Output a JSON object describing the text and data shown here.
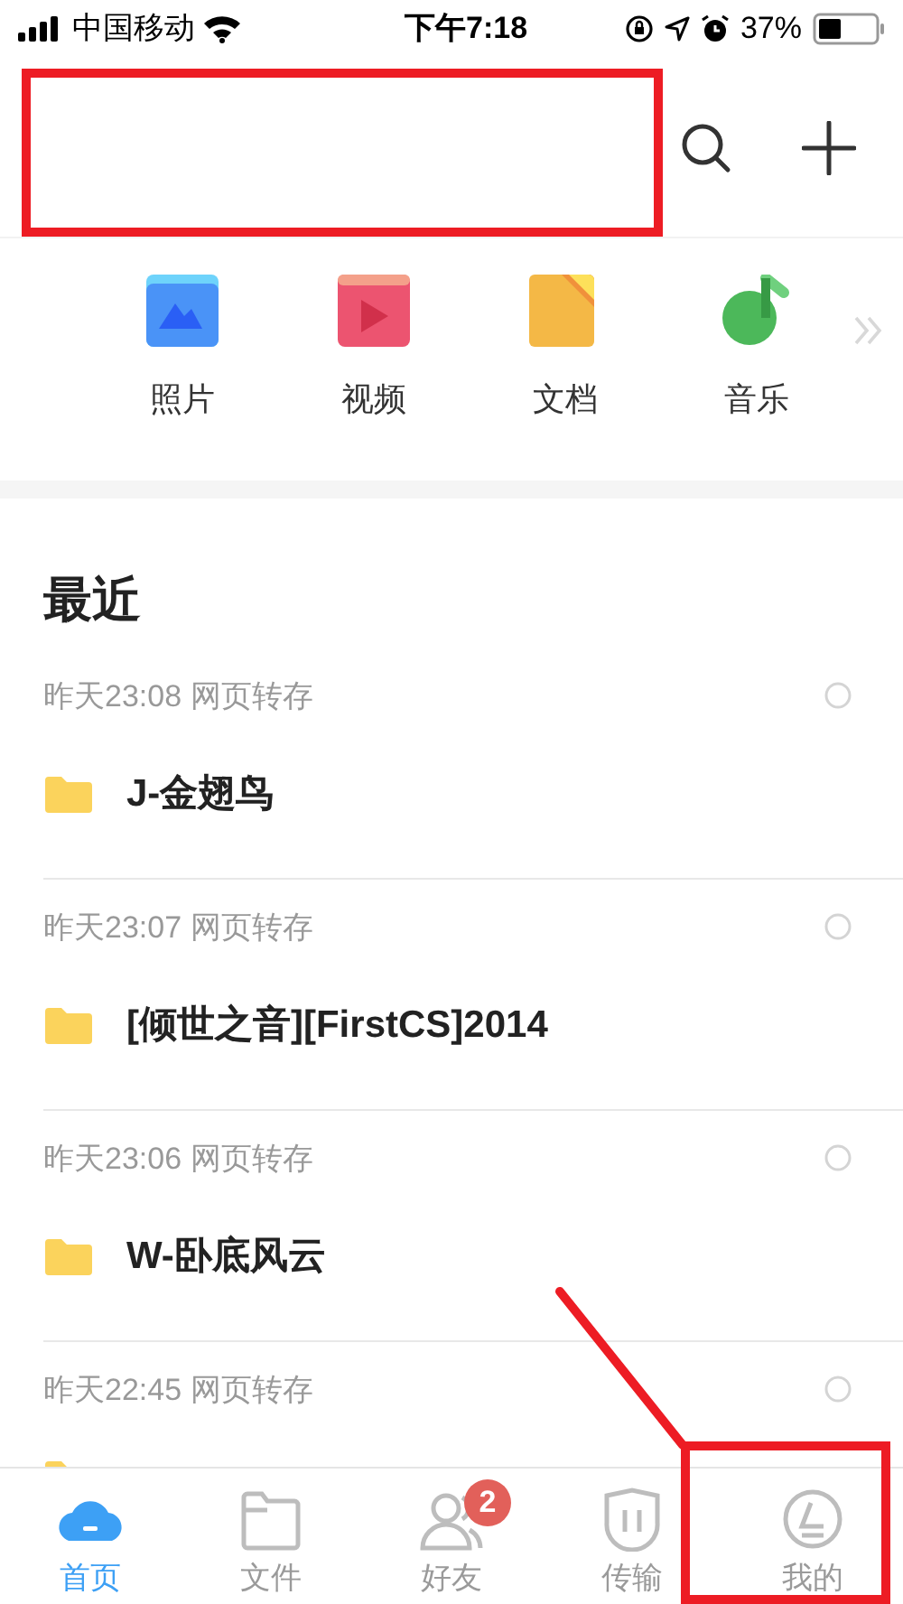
{
  "status_bar": {
    "carrier": "中国移动",
    "time": "下午7:18",
    "battery": "37%"
  },
  "quick_access": [
    {
      "kind": "photo",
      "label": "照片"
    },
    {
      "kind": "video",
      "label": "视频"
    },
    {
      "kind": "doc",
      "label": "文档"
    },
    {
      "kind": "music",
      "label": "音乐"
    }
  ],
  "recent": {
    "title": "最近",
    "items": [
      {
        "meta": "昨天23:08 网页转存",
        "name": "J-金翅鸟"
      },
      {
        "meta": "昨天23:07 网页转存",
        "name": "[倾世之音][FirstCS]2014"
      },
      {
        "meta": "昨天23:06 网页转存",
        "name": "W-卧底风云"
      },
      {
        "meta": "昨天22:45 网页转存"
      }
    ]
  },
  "tab_bar": [
    {
      "kind": "home",
      "label": "首页",
      "selected": true
    },
    {
      "kind": "files",
      "label": "文件",
      "selected": false
    },
    {
      "kind": "friends",
      "label": "好友",
      "selected": false,
      "badge": "2"
    },
    {
      "kind": "transfer",
      "label": "传输",
      "selected": false
    },
    {
      "kind": "me",
      "label": "我的",
      "selected": false
    }
  ],
  "annotations": [
    {
      "kind": "box"
    },
    {
      "kind": "line"
    },
    {
      "kind": "box"
    }
  ]
}
